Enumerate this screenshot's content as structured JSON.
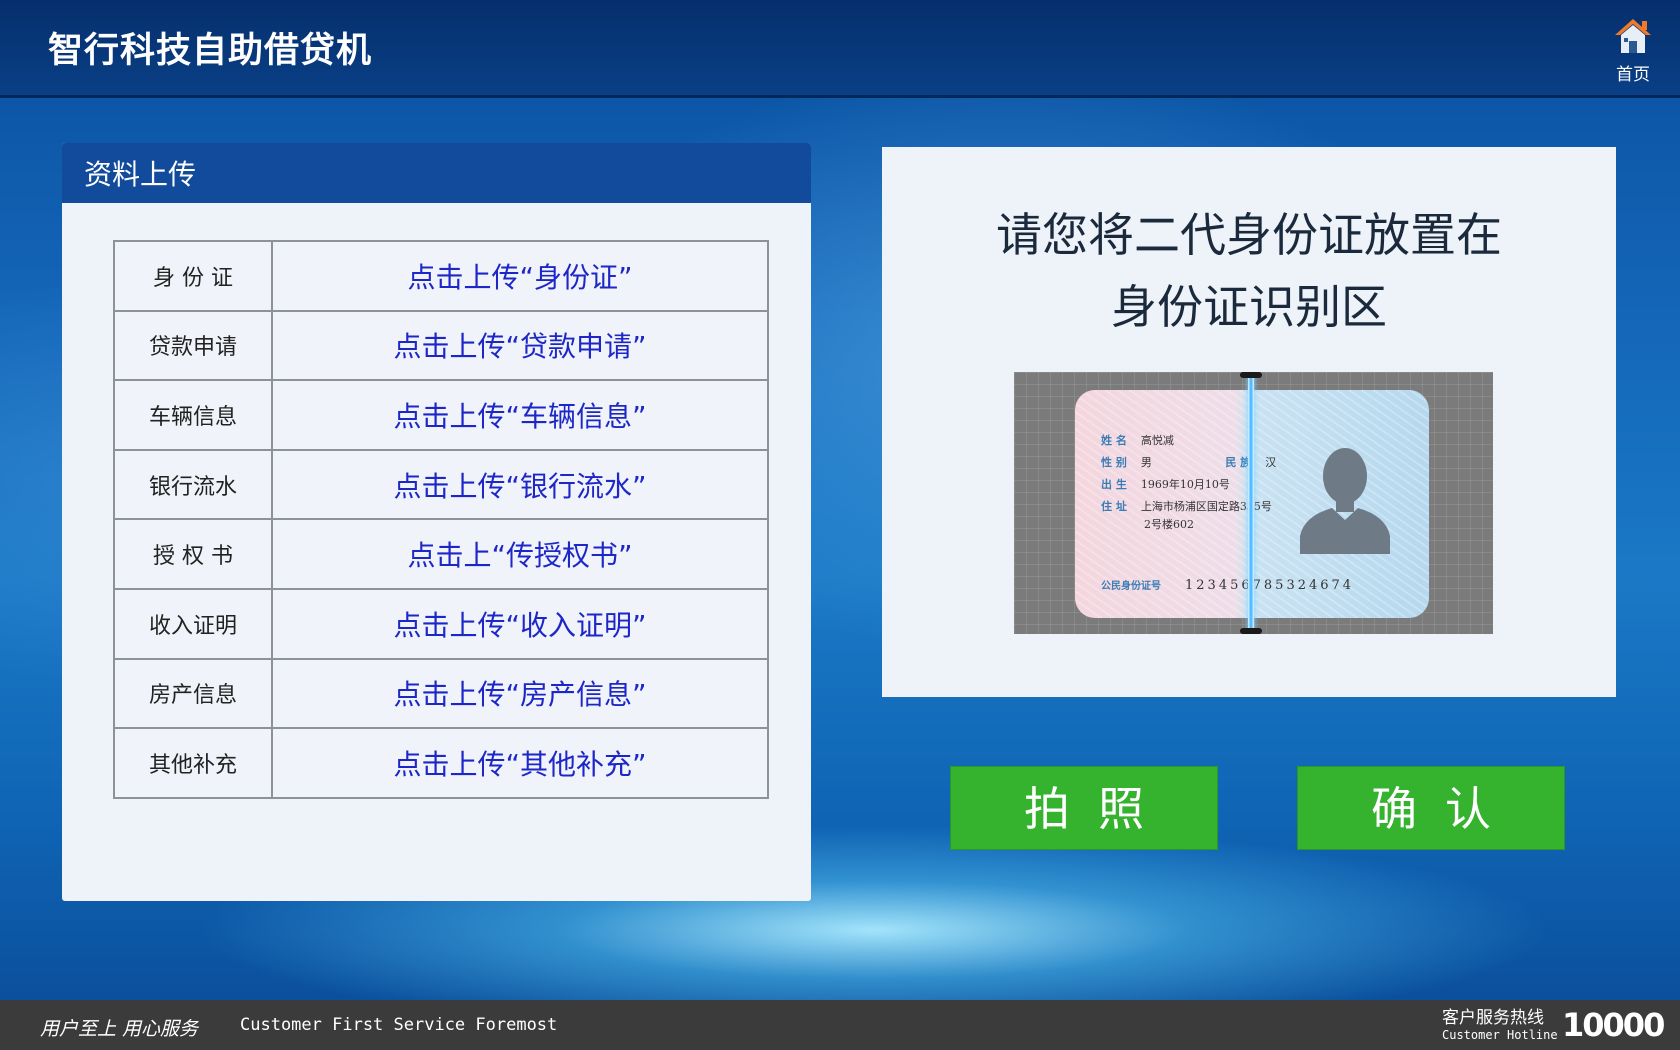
{
  "header": {
    "title": "智行科技自助借贷机",
    "home_label": "首页"
  },
  "upload_panel": {
    "title": "资料上传",
    "rows": [
      {
        "name": "身 份 证",
        "action": "点击上传“身份证”"
      },
      {
        "name": "贷款申请",
        "action": "点击上传“贷款申请”"
      },
      {
        "name": "车辆信息",
        "action": "点击上传“车辆信息”"
      },
      {
        "name": "银行流水",
        "action": "点击上传“银行流水”"
      },
      {
        "name": "授 权 书",
        "action": "点击上“传授权书”"
      },
      {
        "name": "收入证明",
        "action": "点击上传“收入证明”"
      },
      {
        "name": "房产信息",
        "action": "点击上传“房产信息”"
      },
      {
        "name": "其他补充",
        "action": "点击上传“其他补充”"
      }
    ]
  },
  "scan_panel": {
    "instruction_line1": "请您将二代身份证放置在",
    "instruction_line2": "身份证识别区",
    "card": {
      "name_key": "姓 名",
      "name_val": "高悦减",
      "sex_key": "性 别",
      "sex_val": "男",
      "ethnic_key": "民 族",
      "ethnic_val": "汉",
      "birth_key": "出 生",
      "birth_val": "1969年10月10号",
      "addr_key": "住 址",
      "addr_val1": "上海市杨浦区国定路335号",
      "addr_val2": "2号楼602",
      "id_key": "公民身份证号",
      "id_val": "123456785324674"
    }
  },
  "buttons": {
    "photo": "拍照",
    "confirm": "确认"
  },
  "footer": {
    "slogan_cn": "用户至上 用心服务",
    "slogan_en": "Customer First Service Foremost",
    "hotline_label": "客户服务热线",
    "hotline_en": "Customer Hotline",
    "hotline_number": "10000"
  },
  "colors": {
    "header_bg": "#0a3f86",
    "panel_head": "#124b9c",
    "link_blue": "#1d27c8",
    "button_green": "#35b22e",
    "footer_bg": "#3b3b3b"
  }
}
